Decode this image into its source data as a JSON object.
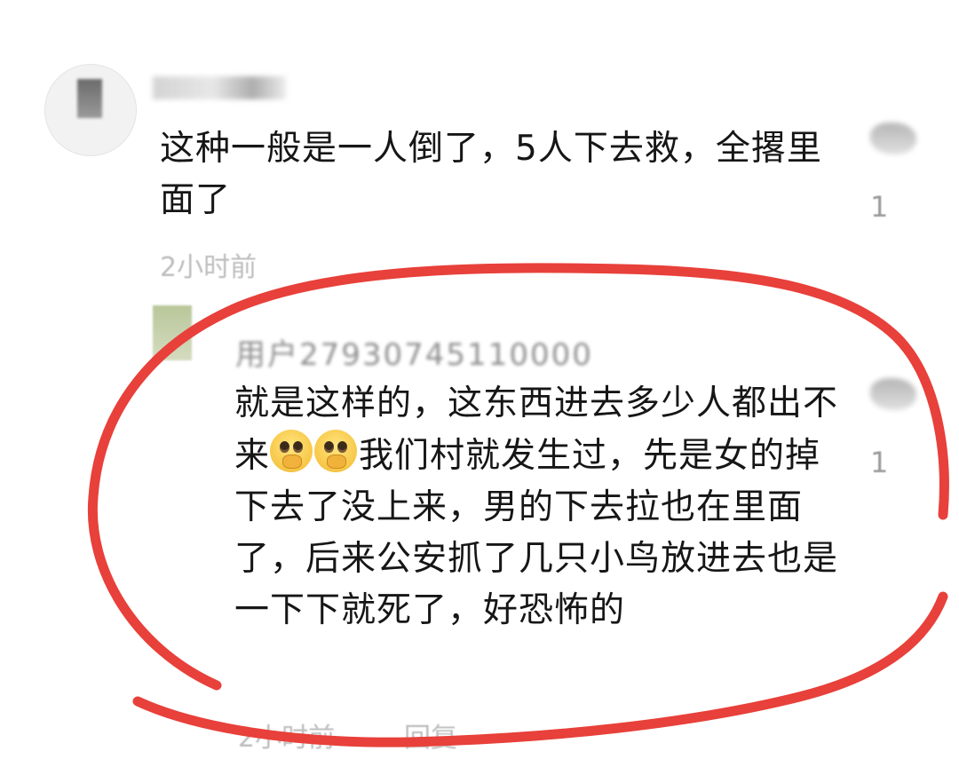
{
  "main_comment": {
    "username": "",
    "text": "这种一般是一人倒了，5人下去救，全撂里面了",
    "time": "2小时前",
    "like_count": "1"
  },
  "reply_comment": {
    "username": "用户27930745110000",
    "text_part1": "就是这样的，这东西进去多少人都出不来",
    "emoji_names": [
      "pleading-face-hands-emoji",
      "pleading-face-hands-emoji"
    ],
    "text_part2": "我们村就发生过，先是女的掉下去了没上来，男的下去拉也在里面了，后来公安抓了几只小鸟放进去也是一下下就死了，好恐怖的",
    "time": "2小时前",
    "reply_label": "回复",
    "like_count": "1"
  },
  "annotation": {
    "shape": "hand-drawn ellipse",
    "color": "#e8403a"
  }
}
